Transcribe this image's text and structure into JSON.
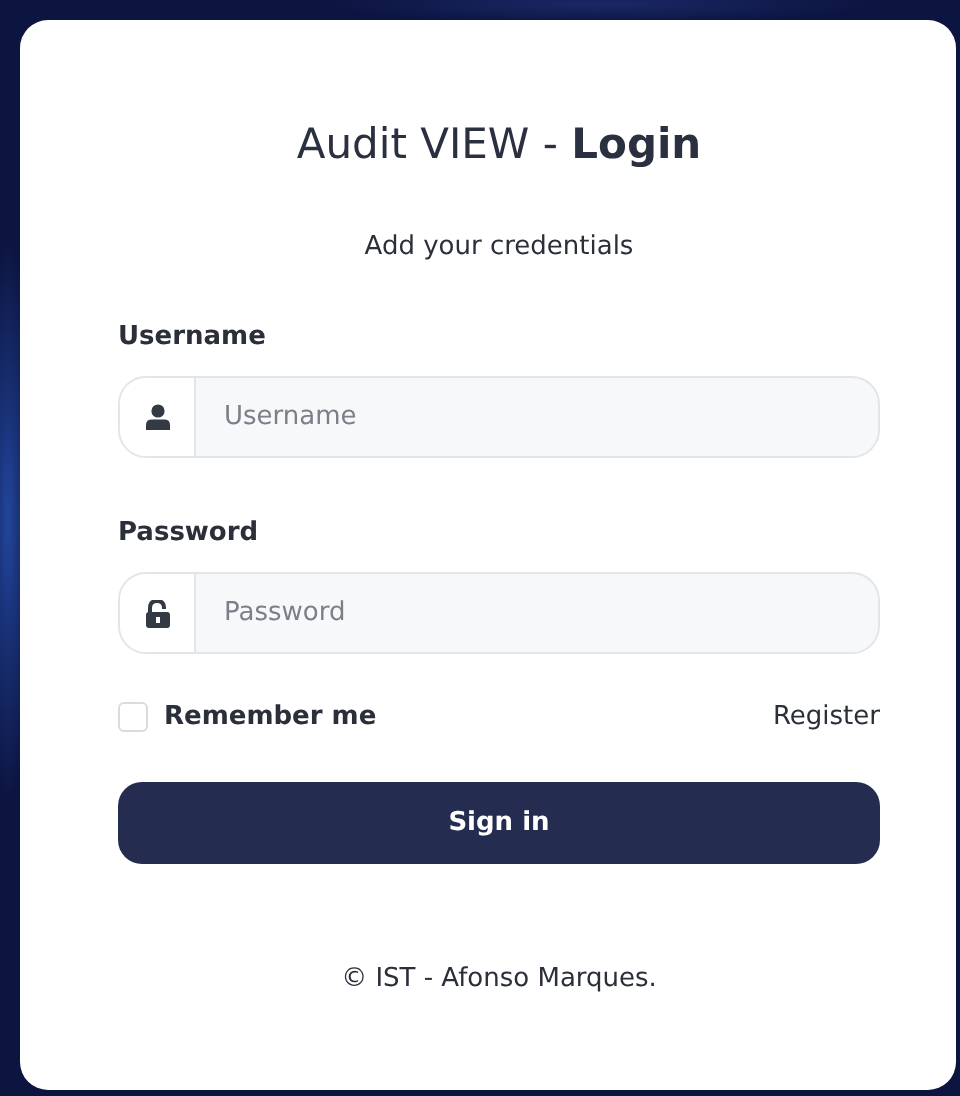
{
  "title": "Audit VIEW - **Login**",
  "subtitle": "Add your credentials",
  "fields": [
    {
      "label": "Username",
      "placeholder": "Username",
      "kind": "text"
    },
    {
      "label": "Password",
      "placeholder": "Password",
      "kind": "password"
    }
  ],
  "remember": {
    "label": "Remember me",
    "checked": false
  },
  "register_link": "Register",
  "sign_in_button": "Sign in",
  "footer": "© IST - Afonso Marques."
}
